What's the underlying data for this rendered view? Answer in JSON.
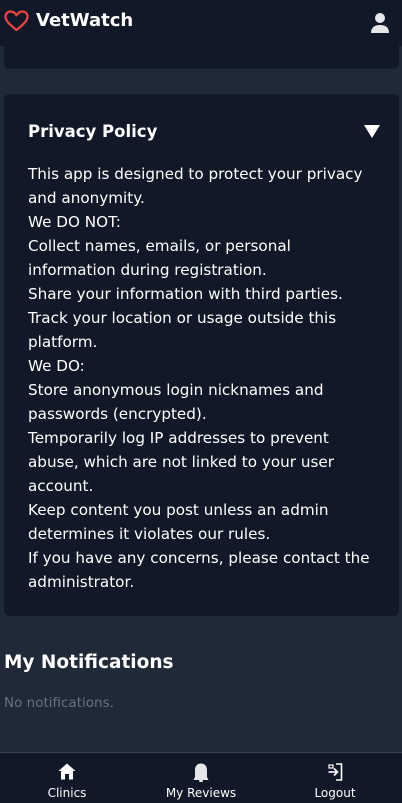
{
  "app": {
    "name": "VetWatch"
  },
  "policy": {
    "title": "Privacy Policy",
    "lines": [
      "This app is designed to protect your privacy and anonymity.",
      "We DO NOT:",
      "Collect names, emails, or personal information during registration.",
      "Share your information with third parties.",
      "Track your location or usage outside this platform.",
      "We DO:",
      "Store anonymous login nicknames and passwords (encrypted).",
      "Temporarily log IP addresses to prevent abuse, which are not linked to your user account.",
      "Keep content you post unless an admin determines it violates our rules.",
      "If you have any concerns, please contact the administrator."
    ]
  },
  "notifications": {
    "title": "My Notifications",
    "empty_text": "No notifications."
  },
  "nav": {
    "items": [
      {
        "label": "Clinics",
        "icon": "home-icon"
      },
      {
        "label": "My Reviews",
        "icon": "bell-icon"
      },
      {
        "label": "Logout",
        "icon": "logout-icon"
      }
    ]
  },
  "colors": {
    "background": "#1f2937",
    "card": "#111827",
    "accent_heart": "#ef4444",
    "muted_text": "#6b7280"
  }
}
